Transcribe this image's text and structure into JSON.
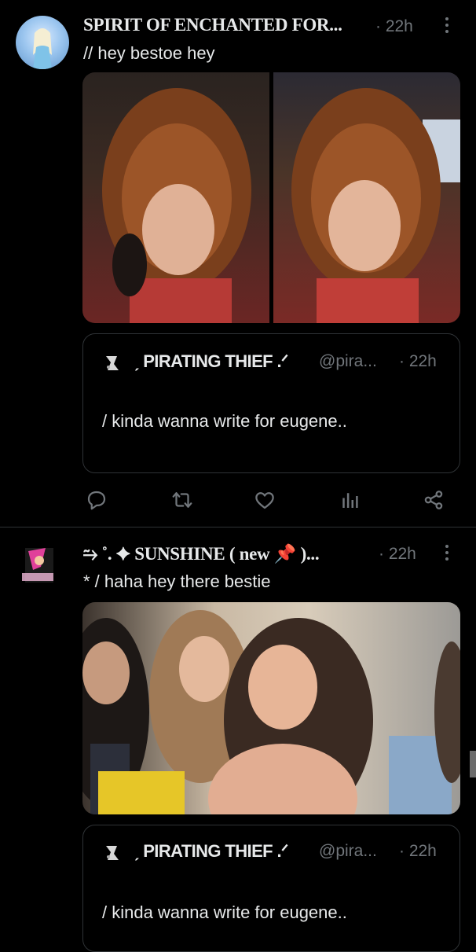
{
  "tweets": [
    {
      "name": "SPIRIT OF ENCHANTED FOR...",
      "time": "· 22h",
      "text": "// hey bestoe hey",
      "quote": {
        "name": "ˏ PIRATING THIEF .ᐟ",
        "handle": "@pira...",
        "time": "· 22h",
        "text": "/ kinda wanna write for eugene.."
      }
    },
    {
      "name": "⥲ ˚. ✦ SUNSHINE ( new 📌 )...",
      "time": "· 22h",
      "text": "* /  haha hey there bestie",
      "quote": {
        "name": "ˏ PIRATING THIEF .ᐟ",
        "handle": "@pira...",
        "time": "· 22h",
        "text": "/ kinda wanna write for eugene.."
      }
    }
  ],
  "icons": {
    "reply": "reply-icon",
    "retweet": "retweet-icon",
    "like": "like-icon",
    "views": "views-icon",
    "share": "share-icon",
    "more": "more-icon"
  },
  "colors": {
    "background": "#000000",
    "text": "#e7e9ea",
    "secondary": "#71767b",
    "border": "#2f3336"
  }
}
